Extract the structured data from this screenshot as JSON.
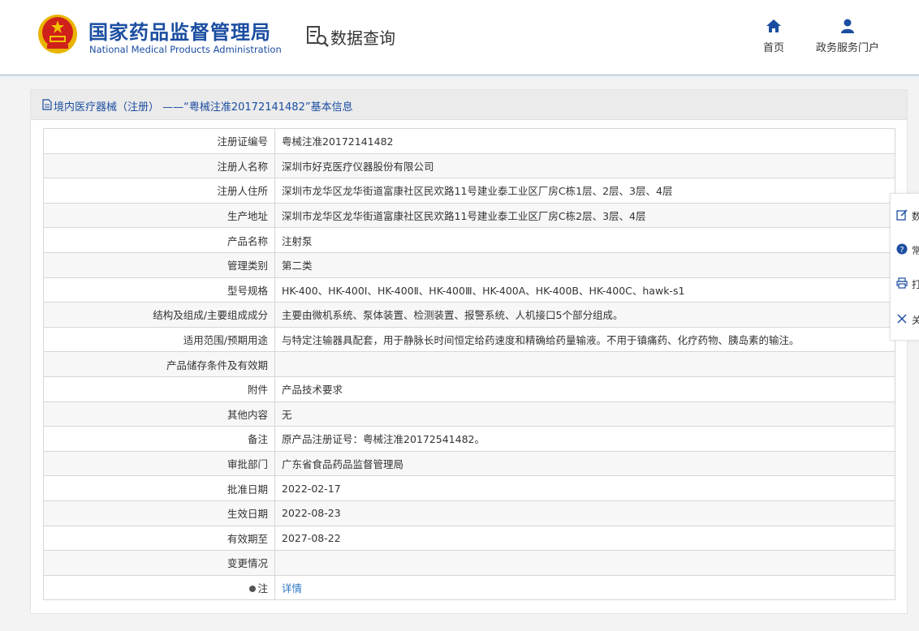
{
  "header": {
    "logo_cn": "国家药品监督管理局",
    "logo_en": "National Medical Products Administration",
    "query_title": "数据查询",
    "nav": [
      {
        "label": "首页",
        "icon": "home-icon"
      },
      {
        "label": "政务服务门户",
        "icon": "user-icon"
      }
    ]
  },
  "panel": {
    "title": "境内医疗器械（注册） ——“粤械注准20172141482”基本信息"
  },
  "rows": [
    {
      "label": "注册证编号",
      "value": "粤械注准20172141482"
    },
    {
      "label": "注册人名称",
      "value": "深圳市好克医疗仪器股份有限公司"
    },
    {
      "label": "注册人住所",
      "value": "深圳市龙华区龙华街道富康社区民欢路11号建业泰工业区厂房C栋1层、2层、3层、4层"
    },
    {
      "label": "生产地址",
      "value": "深圳市龙华区龙华街道富康社区民欢路11号建业泰工业区厂房C栋2层、3层、4层"
    },
    {
      "label": "产品名称",
      "value": "注射泵"
    },
    {
      "label": "管理类别",
      "value": "第二类"
    },
    {
      "label": "型号规格",
      "value": "HK-400、HK-400Ⅰ、HK-400Ⅱ、HK-400Ⅲ、HK-400A、HK-400B、HK-400C、hawk-s1"
    },
    {
      "label": "结构及组成/主要组成成分",
      "value": "主要由微机系统、泵体装置、检测装置、报警系统、人机接口5个部分组成。"
    },
    {
      "label": "适用范围/预期用途",
      "value": "与特定注输器具配套，用于静脉长时间恒定给药速度和精确给药量输液。不用于镇痛药、化疗药物、胰岛素的输注。"
    },
    {
      "label": "产品储存条件及有效期",
      "value": ""
    },
    {
      "label": "附件",
      "value": "产品技术要求"
    },
    {
      "label": "其他内容",
      "value": "无"
    },
    {
      "label": "备注",
      "value": "原产品注册证号：粤械注准20172541482。"
    },
    {
      "label": "审批部门",
      "value": "广东省食品药品监督管理局"
    },
    {
      "label": "批准日期",
      "value": "2022-02-17"
    },
    {
      "label": "生效日期",
      "value": "2022-08-23"
    },
    {
      "label": "有效期至",
      "value": "2027-08-22"
    },
    {
      "label": "变更情况",
      "value": ""
    }
  ],
  "note_row": {
    "label": "注",
    "link": "详情"
  },
  "sidebar": [
    {
      "label": "数",
      "icon": "edit-icon"
    },
    {
      "label": "常",
      "icon": "question-icon"
    },
    {
      "label": "打",
      "icon": "print-icon"
    },
    {
      "label": "关",
      "icon": "close-icon"
    }
  ],
  "colors": {
    "brand_blue": "#1b4ea1",
    "link_blue": "#2a76c6",
    "emblem_red": "#d0201b",
    "emblem_gold": "#f2c200"
  }
}
